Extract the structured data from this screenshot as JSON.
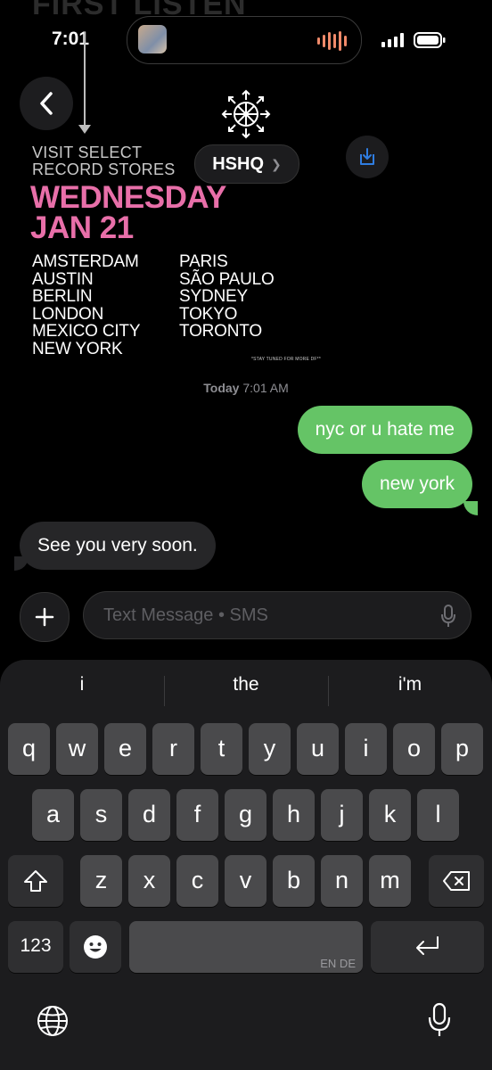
{
  "status_bar": {
    "time": "7:01"
  },
  "background_title": "FIRST LISTEN",
  "header": {
    "contact_name": "HSHQ"
  },
  "poster": {
    "visit_line1": "VISIT SELECT",
    "visit_line2": "RECORD STORES",
    "date_line1": "WEDNESDAY",
    "date_line2": "JAN 21",
    "cities_left": [
      "AMSTERDAM",
      "AUSTIN",
      "BERLIN",
      "LONDON",
      "MEXICO CITY",
      "NEW YORK"
    ],
    "cities_right": [
      "PARIS",
      "SÃO PAULO",
      "SYDNEY",
      "TOKYO",
      "TORONTO"
    ],
    "footer_note": "*STAY TUNED FOR MORE DF**",
    "date_color": "#e86fa9"
  },
  "conversation": {
    "timestamp_day": "Today",
    "timestamp_time": "7:01 AM",
    "messages": [
      {
        "from": "me",
        "text": "nyc or u hate me"
      },
      {
        "from": "me",
        "text": "new york"
      },
      {
        "from": "them",
        "text": "See you very soon."
      }
    ]
  },
  "composer": {
    "placeholder": "Text Message • SMS"
  },
  "keyboard": {
    "suggestions": [
      "i",
      "the",
      "i'm"
    ],
    "row1": [
      "q",
      "w",
      "e",
      "r",
      "t",
      "y",
      "u",
      "i",
      "o",
      "p"
    ],
    "row2": [
      "a",
      "s",
      "d",
      "f",
      "g",
      "h",
      "j",
      "k",
      "l"
    ],
    "row3": [
      "z",
      "x",
      "c",
      "v",
      "b",
      "n",
      "m"
    ],
    "numbers_key": "123",
    "space_lang": "EN DE"
  },
  "colors": {
    "sent_bubble": "#65c466",
    "received_bubble": "#262628",
    "keyboard_bg": "#1c1c1e"
  }
}
